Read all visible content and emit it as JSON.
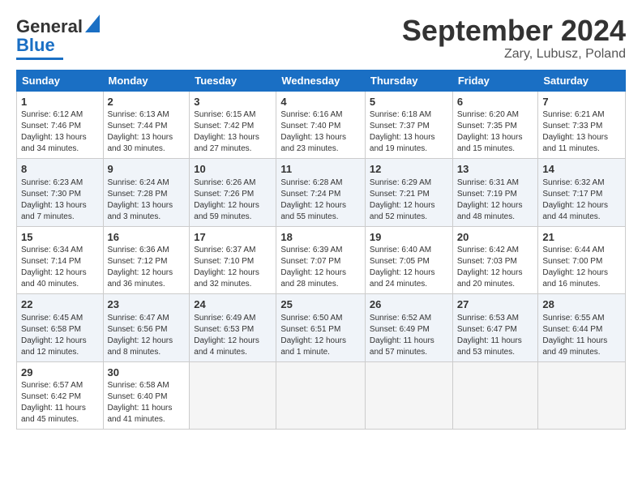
{
  "logo": {
    "line1": "General",
    "line2": "Blue"
  },
  "title": "September 2024",
  "subtitle": "Zary, Lubusz, Poland",
  "days": [
    "Sunday",
    "Monday",
    "Tuesday",
    "Wednesday",
    "Thursday",
    "Friday",
    "Saturday"
  ],
  "weeks": [
    [
      {
        "num": "1",
        "info": "Sunrise: 6:12 AM\nSunset: 7:46 PM\nDaylight: 13 hours\nand 34 minutes."
      },
      {
        "num": "2",
        "info": "Sunrise: 6:13 AM\nSunset: 7:44 PM\nDaylight: 13 hours\nand 30 minutes."
      },
      {
        "num": "3",
        "info": "Sunrise: 6:15 AM\nSunset: 7:42 PM\nDaylight: 13 hours\nand 27 minutes."
      },
      {
        "num": "4",
        "info": "Sunrise: 6:16 AM\nSunset: 7:40 PM\nDaylight: 13 hours\nand 23 minutes."
      },
      {
        "num": "5",
        "info": "Sunrise: 6:18 AM\nSunset: 7:37 PM\nDaylight: 13 hours\nand 19 minutes."
      },
      {
        "num": "6",
        "info": "Sunrise: 6:20 AM\nSunset: 7:35 PM\nDaylight: 13 hours\nand 15 minutes."
      },
      {
        "num": "7",
        "info": "Sunrise: 6:21 AM\nSunset: 7:33 PM\nDaylight: 13 hours\nand 11 minutes."
      }
    ],
    [
      {
        "num": "8",
        "info": "Sunrise: 6:23 AM\nSunset: 7:30 PM\nDaylight: 13 hours\nand 7 minutes."
      },
      {
        "num": "9",
        "info": "Sunrise: 6:24 AM\nSunset: 7:28 PM\nDaylight: 13 hours\nand 3 minutes."
      },
      {
        "num": "10",
        "info": "Sunrise: 6:26 AM\nSunset: 7:26 PM\nDaylight: 12 hours\nand 59 minutes."
      },
      {
        "num": "11",
        "info": "Sunrise: 6:28 AM\nSunset: 7:24 PM\nDaylight: 12 hours\nand 55 minutes."
      },
      {
        "num": "12",
        "info": "Sunrise: 6:29 AM\nSunset: 7:21 PM\nDaylight: 12 hours\nand 52 minutes."
      },
      {
        "num": "13",
        "info": "Sunrise: 6:31 AM\nSunset: 7:19 PM\nDaylight: 12 hours\nand 48 minutes."
      },
      {
        "num": "14",
        "info": "Sunrise: 6:32 AM\nSunset: 7:17 PM\nDaylight: 12 hours\nand 44 minutes."
      }
    ],
    [
      {
        "num": "15",
        "info": "Sunrise: 6:34 AM\nSunset: 7:14 PM\nDaylight: 12 hours\nand 40 minutes."
      },
      {
        "num": "16",
        "info": "Sunrise: 6:36 AM\nSunset: 7:12 PM\nDaylight: 12 hours\nand 36 minutes."
      },
      {
        "num": "17",
        "info": "Sunrise: 6:37 AM\nSunset: 7:10 PM\nDaylight: 12 hours\nand 32 minutes."
      },
      {
        "num": "18",
        "info": "Sunrise: 6:39 AM\nSunset: 7:07 PM\nDaylight: 12 hours\nand 28 minutes."
      },
      {
        "num": "19",
        "info": "Sunrise: 6:40 AM\nSunset: 7:05 PM\nDaylight: 12 hours\nand 24 minutes."
      },
      {
        "num": "20",
        "info": "Sunrise: 6:42 AM\nSunset: 7:03 PM\nDaylight: 12 hours\nand 20 minutes."
      },
      {
        "num": "21",
        "info": "Sunrise: 6:44 AM\nSunset: 7:00 PM\nDaylight: 12 hours\nand 16 minutes."
      }
    ],
    [
      {
        "num": "22",
        "info": "Sunrise: 6:45 AM\nSunset: 6:58 PM\nDaylight: 12 hours\nand 12 minutes."
      },
      {
        "num": "23",
        "info": "Sunrise: 6:47 AM\nSunset: 6:56 PM\nDaylight: 12 hours\nand 8 minutes."
      },
      {
        "num": "24",
        "info": "Sunrise: 6:49 AM\nSunset: 6:53 PM\nDaylight: 12 hours\nand 4 minutes."
      },
      {
        "num": "25",
        "info": "Sunrise: 6:50 AM\nSunset: 6:51 PM\nDaylight: 12 hours\nand 1 minute."
      },
      {
        "num": "26",
        "info": "Sunrise: 6:52 AM\nSunset: 6:49 PM\nDaylight: 11 hours\nand 57 minutes."
      },
      {
        "num": "27",
        "info": "Sunrise: 6:53 AM\nSunset: 6:47 PM\nDaylight: 11 hours\nand 53 minutes."
      },
      {
        "num": "28",
        "info": "Sunrise: 6:55 AM\nSunset: 6:44 PM\nDaylight: 11 hours\nand 49 minutes."
      }
    ],
    [
      {
        "num": "29",
        "info": "Sunrise: 6:57 AM\nSunset: 6:42 PM\nDaylight: 11 hours\nand 45 minutes."
      },
      {
        "num": "30",
        "info": "Sunrise: 6:58 AM\nSunset: 6:40 PM\nDaylight: 11 hours\nand 41 minutes."
      },
      null,
      null,
      null,
      null,
      null
    ]
  ]
}
